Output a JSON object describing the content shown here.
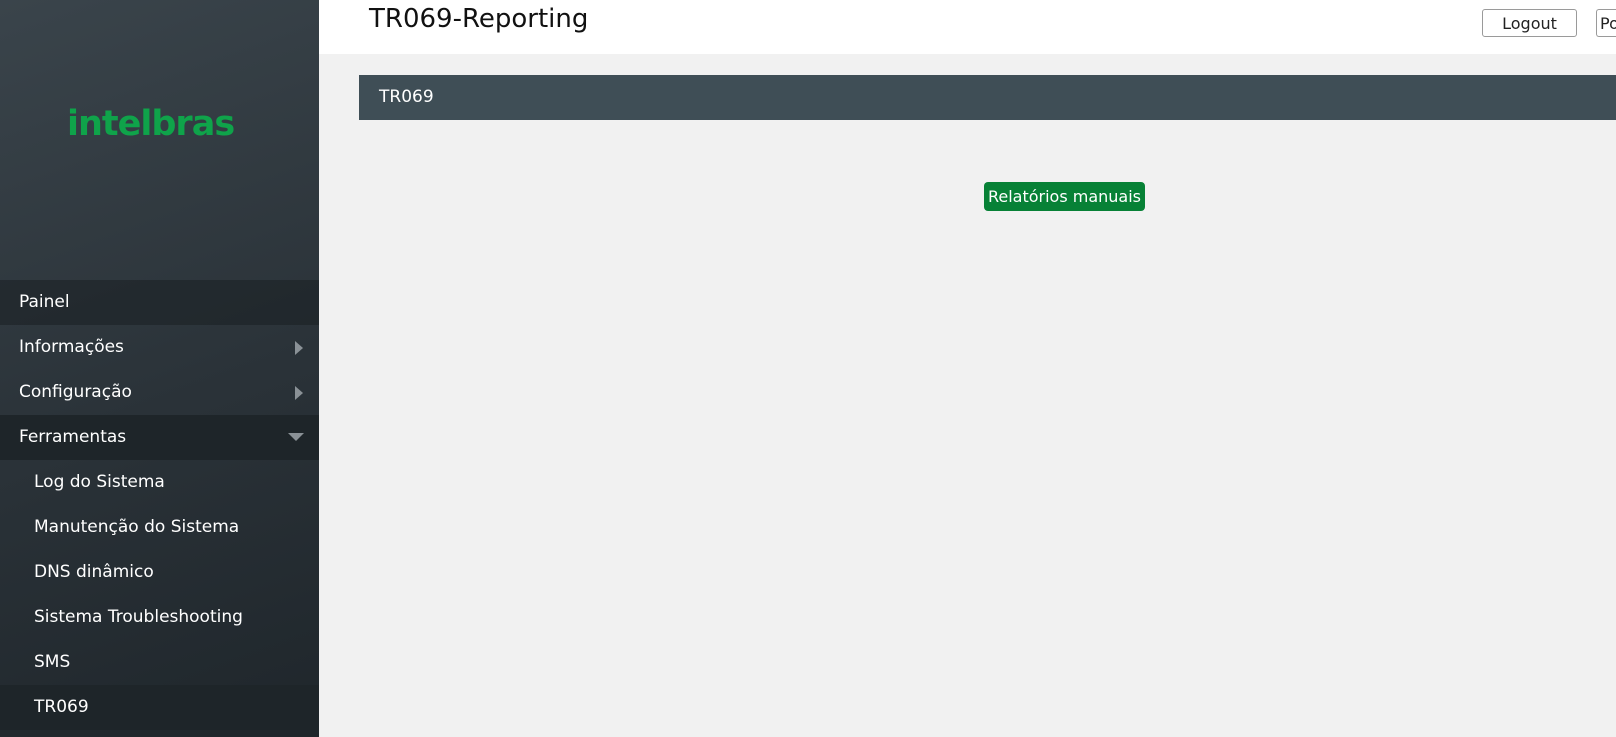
{
  "brand": {
    "logo_text": "intelbras",
    "logo_color": "#0fa34a"
  },
  "header": {
    "title": "TR069-Reporting",
    "logout_label": "Logout",
    "lang_label": "Po"
  },
  "sidebar": {
    "items": [
      {
        "label": "Painel"
      },
      {
        "label": "Informações",
        "icon": "chevron-right-icon"
      },
      {
        "label": "Configuração",
        "icon": "chevron-right-icon"
      },
      {
        "label": "Ferramentas",
        "icon": "chevron-down-icon",
        "expanded": true
      }
    ],
    "subitems": [
      {
        "label": "Log do Sistema"
      },
      {
        "label": "Manutenção do Sistema"
      },
      {
        "label": "DNS dinâmico"
      },
      {
        "label": "Sistema Troubleshooting"
      },
      {
        "label": "SMS"
      },
      {
        "label": "TR069",
        "active": true
      }
    ]
  },
  "main": {
    "section_title": "TR069",
    "manual_report_label": "Relatórios manuais"
  },
  "colors": {
    "accent_green": "#078136",
    "section_header": "#3f4e56",
    "sidebar_dark": "#2a3238"
  }
}
